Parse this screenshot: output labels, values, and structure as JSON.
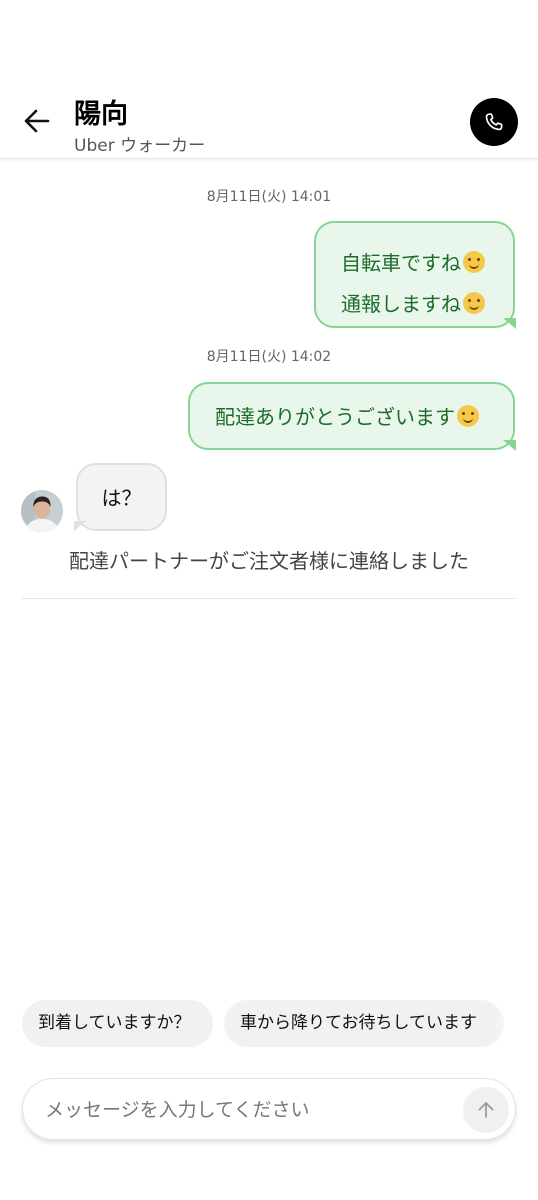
{
  "header": {
    "title": "陽向",
    "subtitle": "Uber ウォーカー",
    "back_icon": "arrow-left-icon",
    "call_icon": "phone-icon"
  },
  "messages": {
    "ts1": "8月11日(火) 14:01",
    "out1_line1": "自転車ですね",
    "out1_line2": "通報しますね",
    "ts2": "8月11日(火) 14:02",
    "out2": "配達ありがとうございます",
    "in1": "は？",
    "system": "配達パートナーがご注文者様に連絡しました"
  },
  "quick_replies": [
    "到着していますか？",
    "車から降りてお待ちしています"
  ],
  "composer": {
    "placeholder": "メッセージを入力してください",
    "send_icon": "arrow-up-icon"
  },
  "colors": {
    "outgoing_bg": "#e9f6eb",
    "outgoing_border": "#88d592",
    "outgoing_text": "#1d6b2b",
    "incoming_bg": "#f3f3f3"
  }
}
